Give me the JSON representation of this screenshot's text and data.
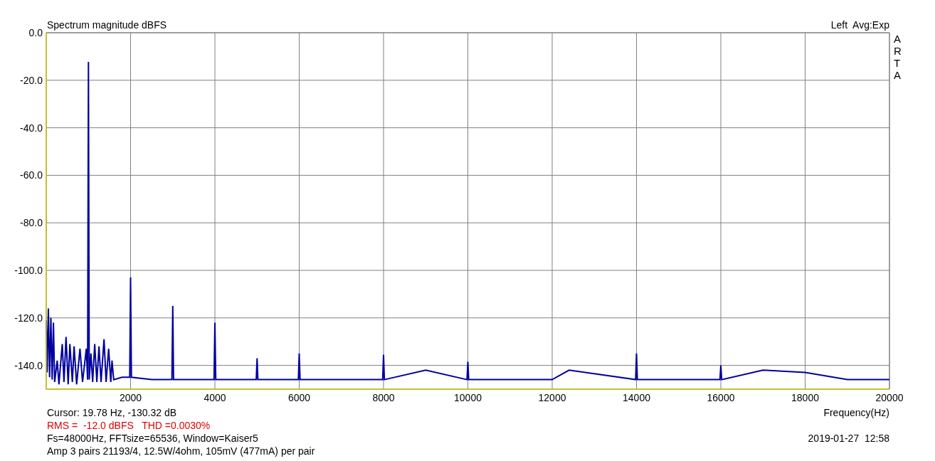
{
  "chart": {
    "channel_label": "Left  Avg:Exp",
    "logo": "ARTA",
    "chart_data": {
      "type": "line",
      "grid": true,
      "title": "Spectrum magnitude dBFS",
      "xlabel": "Frequency(Hz)",
      "xlim": [
        0,
        20000
      ],
      "ylim": [
        -150,
        0
      ],
      "xticks": [
        2000,
        4000,
        6000,
        8000,
        10000,
        12000,
        14000,
        16000,
        18000,
        20000
      ],
      "yticks": [
        {
          "value": 0,
          "label": "0.0"
        },
        {
          "value": -20,
          "label": "-20.0"
        },
        {
          "value": -40,
          "label": "-40.0"
        },
        {
          "value": -60,
          "label": "-60.0"
        },
        {
          "value": -80,
          "label": "-80.0"
        },
        {
          "value": -100,
          "label": "-100.0"
        },
        {
          "value": -120,
          "label": "-120.0"
        },
        {
          "value": -140,
          "label": "-140.0"
        }
      ],
      "x": [
        0,
        20,
        50,
        80,
        110,
        140,
        170,
        200,
        260,
        300,
        380,
        420,
        470,
        520,
        560,
        620,
        660,
        720,
        800,
        860,
        950,
        980,
        1000,
        1020,
        1060,
        1100,
        1150,
        1200,
        1250,
        1300,
        1370,
        1420,
        1480,
        1530,
        1560,
        1600,
        1800,
        1980,
        2000,
        2020,
        2500,
        2980,
        3000,
        3020,
        3500,
        3980,
        4000,
        4020,
        4500,
        4980,
        5000,
        5020,
        5500,
        5980,
        6000,
        6020,
        7000,
        7980,
        8000,
        8020,
        9000,
        9980,
        10000,
        10020,
        12000,
        12400,
        13980,
        14000,
        14020,
        15000,
        15980,
        16000,
        16020,
        17000,
        18000,
        19000,
        20000
      ],
      "series": [
        {
          "color": "#0000a0",
          "values": [
            -121,
            -143,
            -116,
            -145,
            -120,
            -146,
            -122,
            -147,
            -138,
            -148,
            -131,
            -147,
            -128,
            -148,
            -131,
            -147,
            -132,
            -148,
            -133,
            -147,
            -133,
            -146,
            -12.3,
            -146,
            -135,
            -147,
            -131,
            -147,
            -132,
            -147,
            -129,
            -147,
            -133,
            -147,
            -138,
            -146,
            -145,
            -145,
            -103,
            -145,
            -146,
            -146,
            -115,
            -146,
            -146,
            -146,
            -122,
            -146,
            -146,
            -146,
            -137,
            -146,
            -146,
            -146,
            -135,
            -146,
            -146,
            -146,
            -135.5,
            -146,
            -142,
            -146,
            -138.5,
            -146,
            -146,
            -142,
            -146,
            -135,
            -146,
            -146,
            -146,
            -140,
            -146,
            -142,
            -143,
            -146,
            -146
          ]
        }
      ]
    }
  },
  "readout": {
    "cursor": "Cursor: 19.78 Hz, -130.32 dB",
    "measurement": "RMS =  -12.0 dBFS   THD =0.0030%",
    "settings": "Fs=48000Hz, FFTsize=65536, Window=Kaiser5",
    "note": "Amp 3 pairs 21193/4, 12.5W/4ohm, 105mV (477mA) per pair",
    "timestamp": "2019-01-27  12:58"
  }
}
